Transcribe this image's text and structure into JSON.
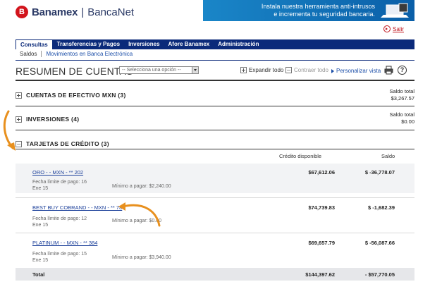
{
  "header": {
    "logo_initial": "B",
    "brand": "Banamex",
    "separator": "|",
    "product": "BancaNet",
    "banner_line1": "Instala nuestra herramienta anti-intrusos",
    "banner_line2": "e incrementa tu seguridad bancaria.",
    "exit_label": "Salir"
  },
  "nav": {
    "tabs": [
      {
        "label": "Consultas",
        "active": true
      },
      {
        "label": "Transferencias y Pagos",
        "active": false
      },
      {
        "label": "Inversiones",
        "active": false
      },
      {
        "label": "Afore Banamex",
        "active": false
      },
      {
        "label": "Administración",
        "active": false
      }
    ],
    "subnav": [
      {
        "label": "Saldos"
      },
      {
        "label": "Movimientos en Banca Electrónica"
      }
    ]
  },
  "toolbar": {
    "title": "RESUMEN DE CUENTAS",
    "select_placeholder": "-- Selecciona una opción --",
    "expand_all": "Expandir todo",
    "collapse_all": "Contraer todo",
    "customize": "Personalizar vista",
    "help": "?"
  },
  "sections": [
    {
      "title": "CUENTAS DE EFECTIVO MXN  (3)",
      "right_label": "Saldo total",
      "right_value": "$3,267.57"
    },
    {
      "title": "INVERSIONES  (4)",
      "right_label": "Saldo total",
      "right_value": "$0.00"
    },
    {
      "title": "TARJETAS DE CRÉDITO  (3)"
    }
  ],
  "credit_table": {
    "col_credit": "Crédito disponible",
    "col_balance": "Saldo",
    "rows": [
      {
        "name": "ORO - - MXN - ** 202",
        "due_label": "Fecha límite de pago: 16",
        "due_month": "Ene 15",
        "min_pay": "Mínimo a pagar: $2,240.00",
        "credit": "$67,612.06",
        "balance": "$ -36,778.07"
      },
      {
        "name": "BEST BUY COBRAND - - MXN - ** 78",
        "due_label": "Fecha límite de pago: 12",
        "due_month": "Ene 15",
        "min_pay": "Mínimo a pagar: $0.00",
        "credit": "$74,739.83",
        "balance": "$ -1,682.39"
      },
      {
        "name": "PLATINUM - - MXN - ** 384",
        "due_label": "Fecha límite de pago: 15",
        "due_month": "Ene 15",
        "min_pay": "Mínimo a pagar: $3,940.00",
        "credit": "$69,657.79",
        "balance": "$ -56,087.66"
      }
    ],
    "total_label": "Total",
    "total_credit": "$144,397.62",
    "total_balance": "- $57,770.05"
  },
  "colors": {
    "brand_red": "#d2141c",
    "nav_blue": "#0b2a7a",
    "link_blue": "#1b3f9a",
    "annotation_orange": "#e8901e"
  }
}
